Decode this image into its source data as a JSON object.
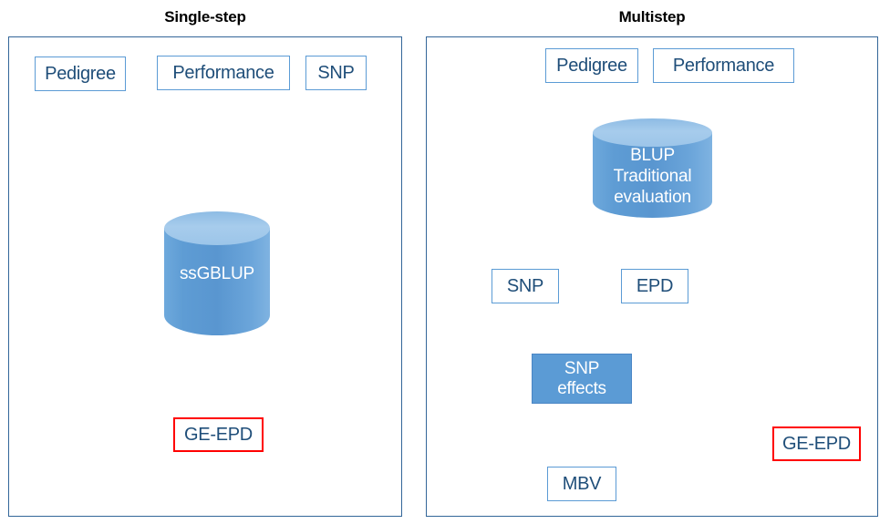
{
  "panels": [
    {
      "id": "single-step",
      "title": "Single-step",
      "nodes": {
        "pedigree": "Pedigree",
        "performance": "Performance",
        "snp": "SNP",
        "ssgblup": "ssGBLUP",
        "ge_epd": "GE-EPD"
      }
    },
    {
      "id": "multistep",
      "title": "Multistep",
      "nodes": {
        "pedigree": "Pedigree",
        "performance": "Performance",
        "blup_line1": "BLUP",
        "blup_line2": "Traditional",
        "blup_line3": "evaluation",
        "snp": "SNP",
        "epd": "EPD",
        "snp_effects_line1": "SNP",
        "snp_effects_line2": "effects",
        "mbv": "MBV",
        "ge_epd": "GE-EPD"
      }
    }
  ],
  "colors": {
    "panel_border": "#336699",
    "box_border": "#5B9BD5",
    "box_text": "#1F4E79",
    "result_border": "#FF0000",
    "cylinder_fill": "#5B9BD5",
    "cylinder_top": "#A7CCEC",
    "filled_box": "#5B9BD5",
    "blue_arrow": "#5B9BD5",
    "red_arrow": "#FF0000",
    "title_text": "#000000"
  }
}
